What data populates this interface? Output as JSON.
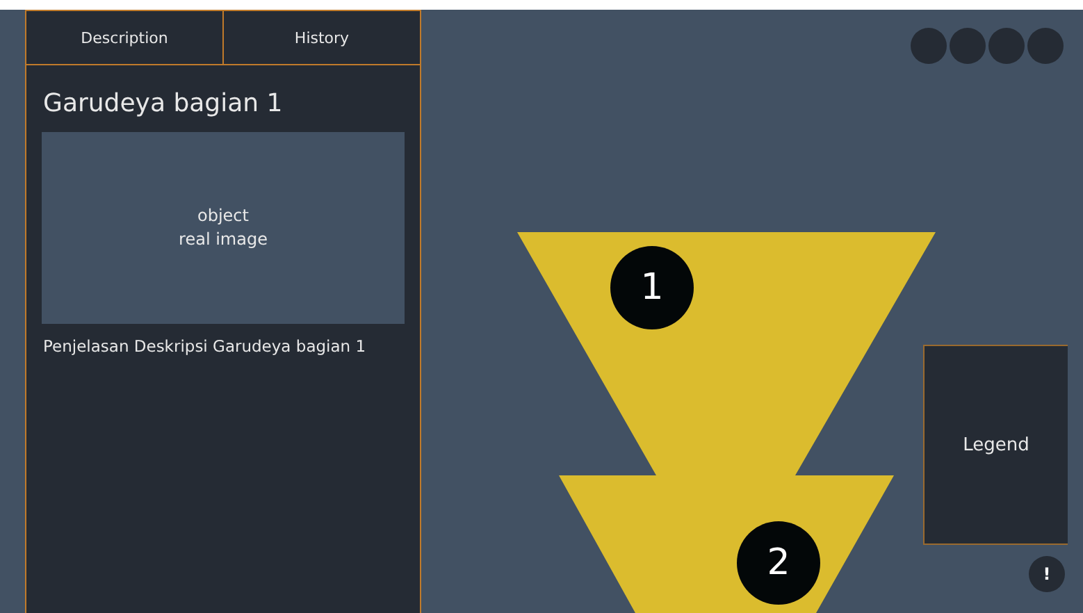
{
  "tabs": [
    {
      "label": "Description"
    },
    {
      "label": "History"
    }
  ],
  "detail": {
    "title": "Garudeya bagian 1",
    "image_placeholder": [
      "object",
      "real image"
    ],
    "description": "Penjelasan Deskripsi Garudeya bagian 1"
  },
  "markers": [
    {
      "label": "1"
    },
    {
      "label": "2"
    }
  ],
  "legend": {
    "label": "Legend"
  },
  "help_button": {
    "label": "!"
  }
}
